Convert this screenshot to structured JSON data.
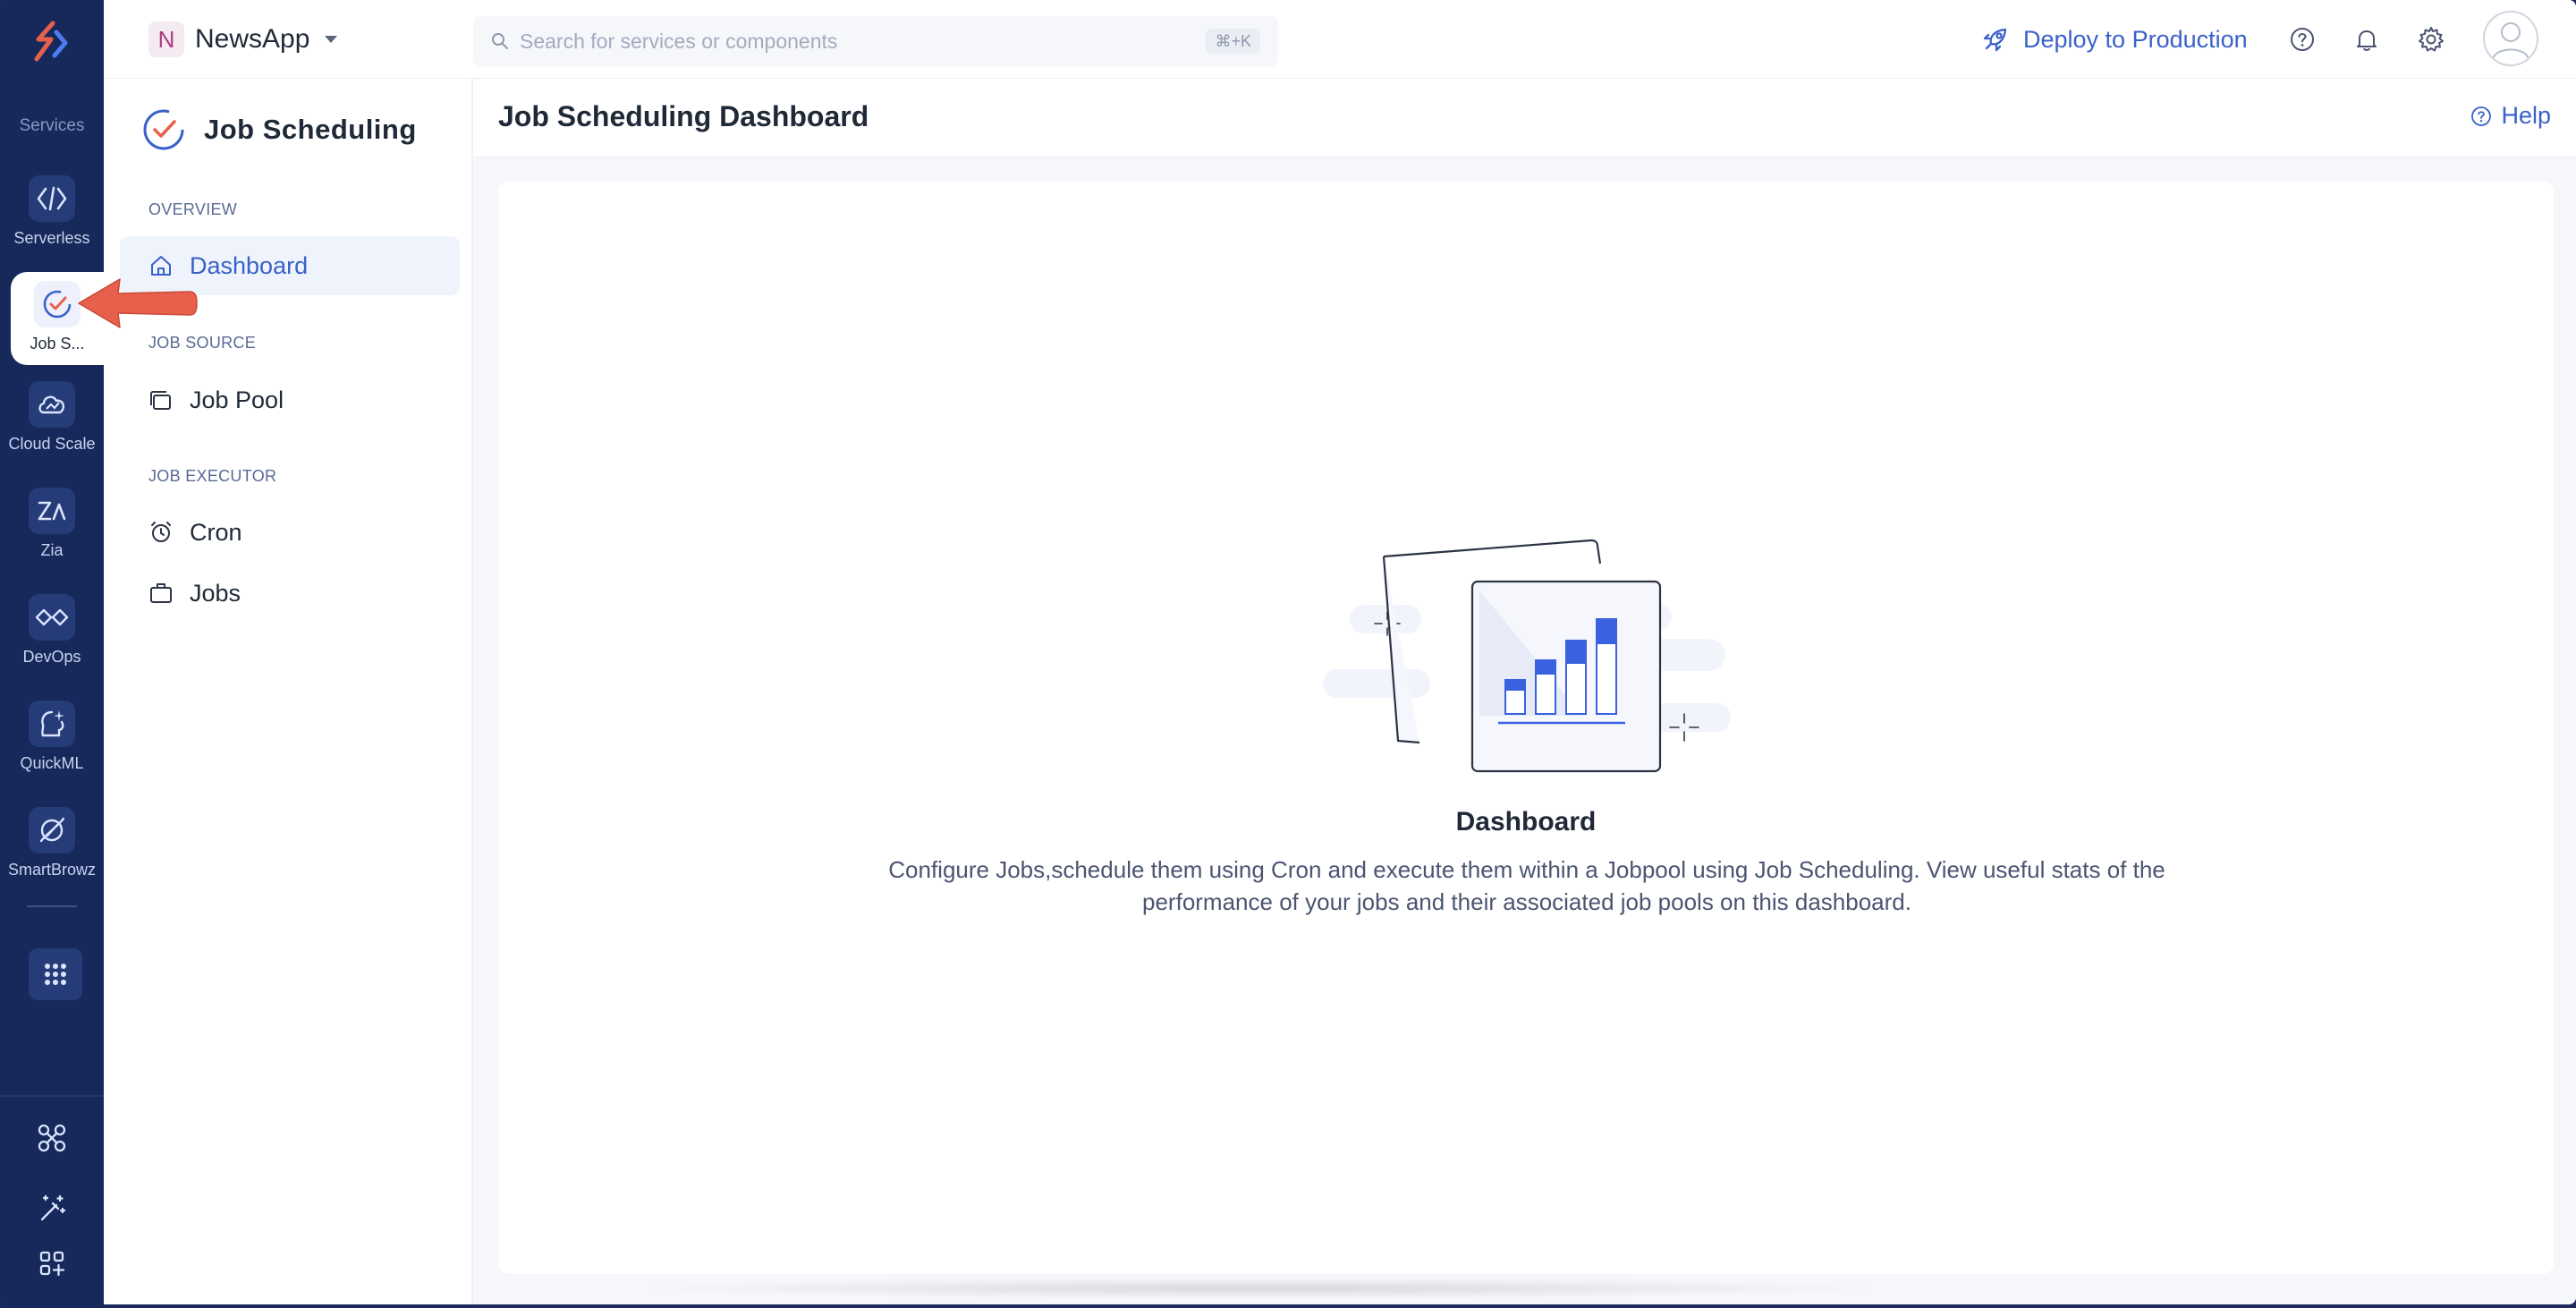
{
  "rail": {
    "services_label": "Services",
    "items": [
      {
        "label": "Serverless",
        "icon": "serverless-icon"
      },
      {
        "label": "Job S...",
        "icon": "job-scheduling-icon",
        "active": true
      },
      {
        "label": "Cloud Scale",
        "icon": "cloud-scale-icon"
      },
      {
        "label": "Zia",
        "icon": "zia-icon"
      },
      {
        "label": "DevOps",
        "icon": "devops-icon"
      },
      {
        "label": "QuickML",
        "icon": "quickml-icon"
      },
      {
        "label": "SmartBrowz",
        "icon": "smartbrowz-icon"
      }
    ]
  },
  "topbar": {
    "project_initial": "N",
    "project_name": "NewsApp",
    "search_placeholder": "Search for services or components",
    "search_shortcut": "⌘+K",
    "deploy_label": "Deploy to Production"
  },
  "sidebar": {
    "title": "Job Scheduling",
    "sections": [
      {
        "label": "OVERVIEW",
        "items": [
          {
            "label": "Dashboard",
            "icon": "home-icon",
            "active": true
          }
        ]
      },
      {
        "label": "JOB SOURCE",
        "items": [
          {
            "label": "Job Pool",
            "icon": "job-pool-icon"
          }
        ]
      },
      {
        "label": "JOB EXECUTOR",
        "items": [
          {
            "label": "Cron",
            "icon": "alarm-clock-icon"
          },
          {
            "label": "Jobs",
            "icon": "briefcase-icon"
          }
        ]
      }
    ]
  },
  "main": {
    "page_title": "Job Scheduling Dashboard",
    "help_label": "Help",
    "empty_title": "Dashboard",
    "empty_description": "Configure Jobs,schedule them using Cron and execute them within a Jobpool using Job Scheduling. View useful stats of the performance of your jobs and their associated job pools on this dashboard."
  },
  "colors": {
    "rail_bg": "#17295a",
    "accent": "#3a61c9",
    "annotation_arrow": "#e8604c",
    "chart_bar": "#3a61e0"
  }
}
